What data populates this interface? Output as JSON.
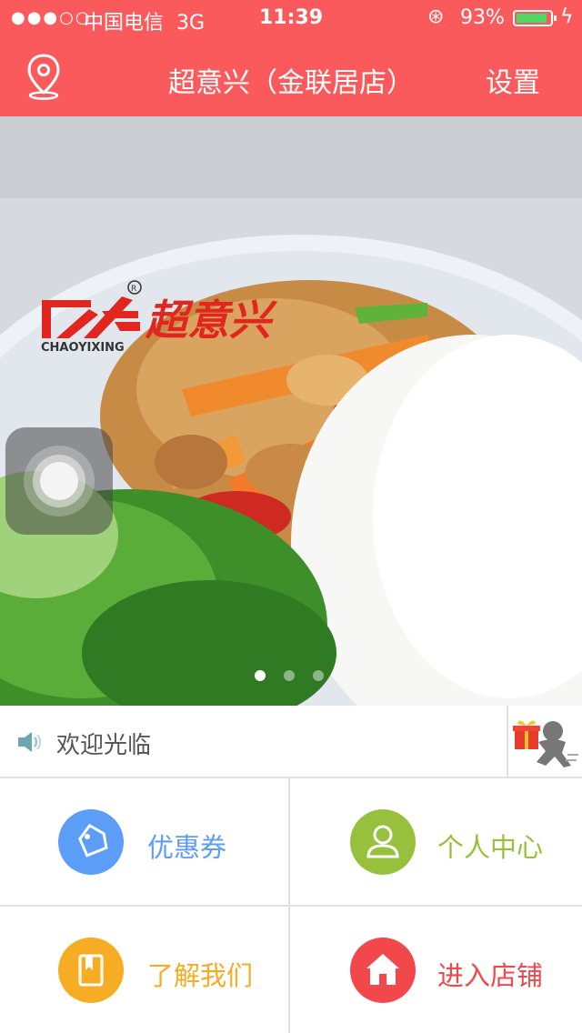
{
  "status_bar": {
    "signal": "●●●○○",
    "carrier": "中国电信",
    "network": "3G",
    "time": "11:39",
    "battery_percent": "93%",
    "battery_level": 0.93,
    "battery_color": "#4cd964"
  },
  "header": {
    "title": "超意兴（金联居店）",
    "settings_label": "设置",
    "background": "#fb5a5c",
    "location_icon": "location-pin-icon"
  },
  "banner": {
    "brand_name": "超意兴",
    "brand_latin": "CHAOYIXING",
    "slide_count": 3,
    "active_slide": 0
  },
  "notice": {
    "text": "欢迎光临",
    "speaker_icon": "speaker-icon",
    "gift_icon": "gift-delivery-icon"
  },
  "menu": [
    {
      "label": "优惠券",
      "color": "#5b9df7",
      "icon": "coupon-tag-icon"
    },
    {
      "label": "个人中心",
      "color": "#97c13c",
      "icon": "user-icon"
    },
    {
      "label": "了解我们",
      "color": "#f6ad23",
      "icon": "book-icon"
    },
    {
      "label": "进入店铺",
      "color": "#f2474b",
      "icon": "home-icon"
    }
  ]
}
